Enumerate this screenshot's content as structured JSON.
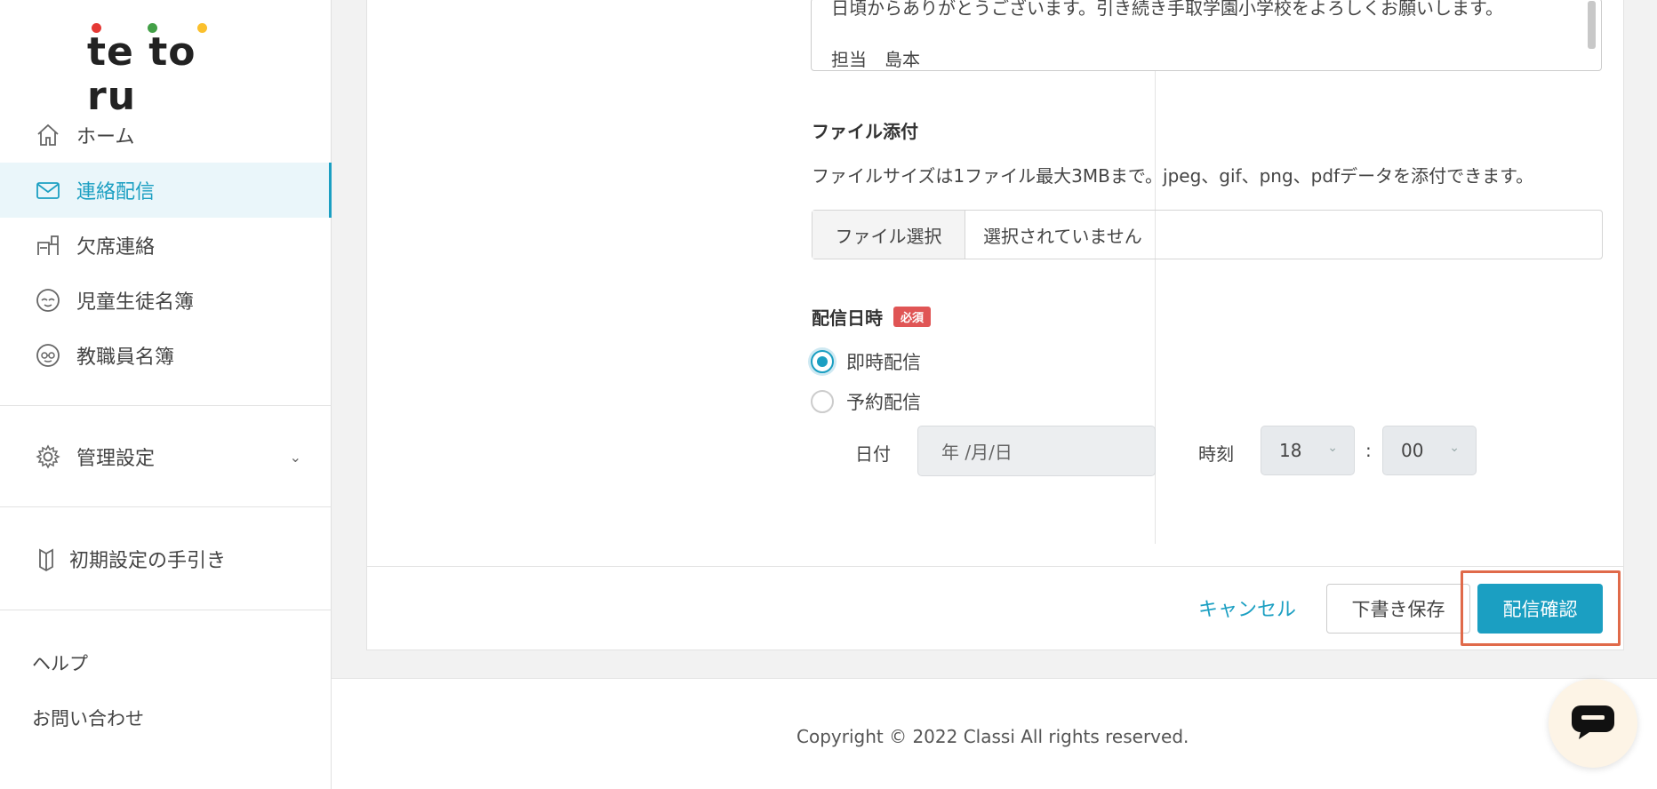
{
  "brand": {
    "logo_text": "te to ru",
    "dot_colors": [
      "#e53935",
      "#43a047",
      "#fbc02d"
    ]
  },
  "sidebar": {
    "items": [
      {
        "label": "ホーム",
        "icon": "home-icon"
      },
      {
        "label": "連絡配信",
        "icon": "mail-icon",
        "active": true
      },
      {
        "label": "欠席連絡",
        "icon": "desk-icon"
      },
      {
        "label": "児童生徒名簿",
        "icon": "student-face-icon"
      },
      {
        "label": "教職員名簿",
        "icon": "teacher-face-icon"
      }
    ],
    "settings_label": "管理設定",
    "guide_label": "初期設定の手引き",
    "help_label": "ヘルプ",
    "contact_label": "お問い合わせ"
  },
  "form": {
    "message_line1": "日頃からありがとうございます。引き続き手取学園小学校をよろしくお願いします。",
    "message_line2": "担当　島本",
    "attachment": {
      "title": "ファイル添付",
      "note": "ファイルサイズは1ファイル最大3MBまで。jpeg、gif、png、pdfデータを添付できます。",
      "button_label": "ファイル選択",
      "status": "選択されていません"
    },
    "delivery": {
      "title": "配信日時",
      "required_badge": "必須",
      "option_immediate": "即時配信",
      "option_scheduled": "予約配信",
      "selected": "即時配信",
      "date_label": "日付",
      "date_placeholder": "年 /月/日",
      "time_label": "時刻",
      "hour": "18",
      "separator": ":",
      "minute": "00"
    }
  },
  "actions": {
    "cancel_label": "キャンセル",
    "draft_label": "下書き保存",
    "confirm_label": "配信確認"
  },
  "footer": {
    "copyright": "Copyright © 2022 Classi All rights reserved."
  },
  "colors": {
    "accent": "#1b9fc2",
    "required": "#e05555",
    "highlight": "#e06a4a"
  }
}
